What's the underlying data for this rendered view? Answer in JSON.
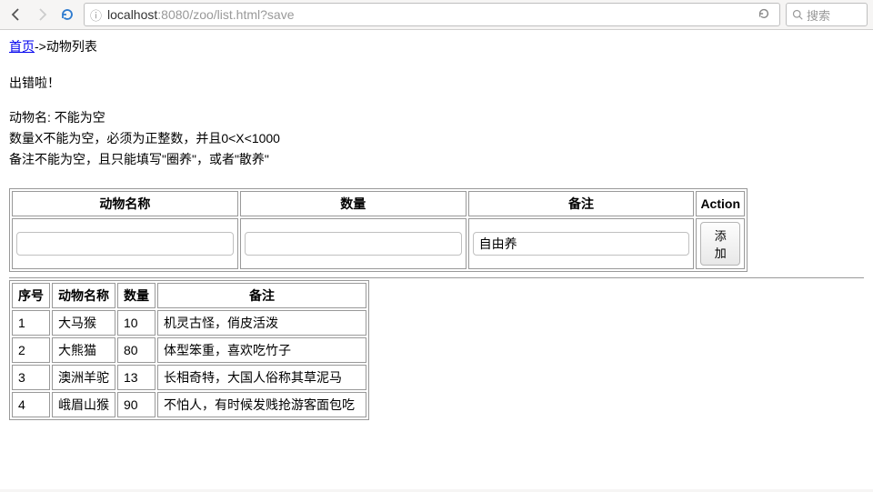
{
  "browser": {
    "url_host": "localhost",
    "url_rest": ":8080/zoo/list.html?save",
    "search_placeholder": "搜索"
  },
  "breadcrumb": {
    "home_link": "首页",
    "sep": "->",
    "current": "动物列表"
  },
  "errors": {
    "title": "出错啦！",
    "messages": [
      "动物名: 不能为空",
      "数量X不能为空，必须为正整数，并且0<X<1000",
      "备注不能为空，且只能填写\"圈养\"，或者\"散养\""
    ]
  },
  "form": {
    "headers": {
      "name": "动物名称",
      "qty": "数量",
      "remark": "备注",
      "action": "Action"
    },
    "values": {
      "name": "",
      "qty": "",
      "remark": "自由养"
    },
    "add_label": "添加"
  },
  "list": {
    "headers": {
      "idx": "序号",
      "name": "动物名称",
      "qty": "数量",
      "remark": "备注"
    },
    "rows": [
      {
        "idx": "1",
        "name": "大马猴",
        "qty": "10",
        "remark": "机灵古怪，俏皮活泼"
      },
      {
        "idx": "2",
        "name": "大熊猫",
        "qty": "80",
        "remark": "体型笨重，喜欢吃竹子"
      },
      {
        "idx": "3",
        "name": "澳洲羊驼",
        "qty": "13",
        "remark": "长相奇特，大国人俗称其草泥马"
      },
      {
        "idx": "4",
        "name": "峨眉山猴",
        "qty": "90",
        "remark": "不怕人，有时候发贱抢游客面包吃"
      }
    ]
  }
}
